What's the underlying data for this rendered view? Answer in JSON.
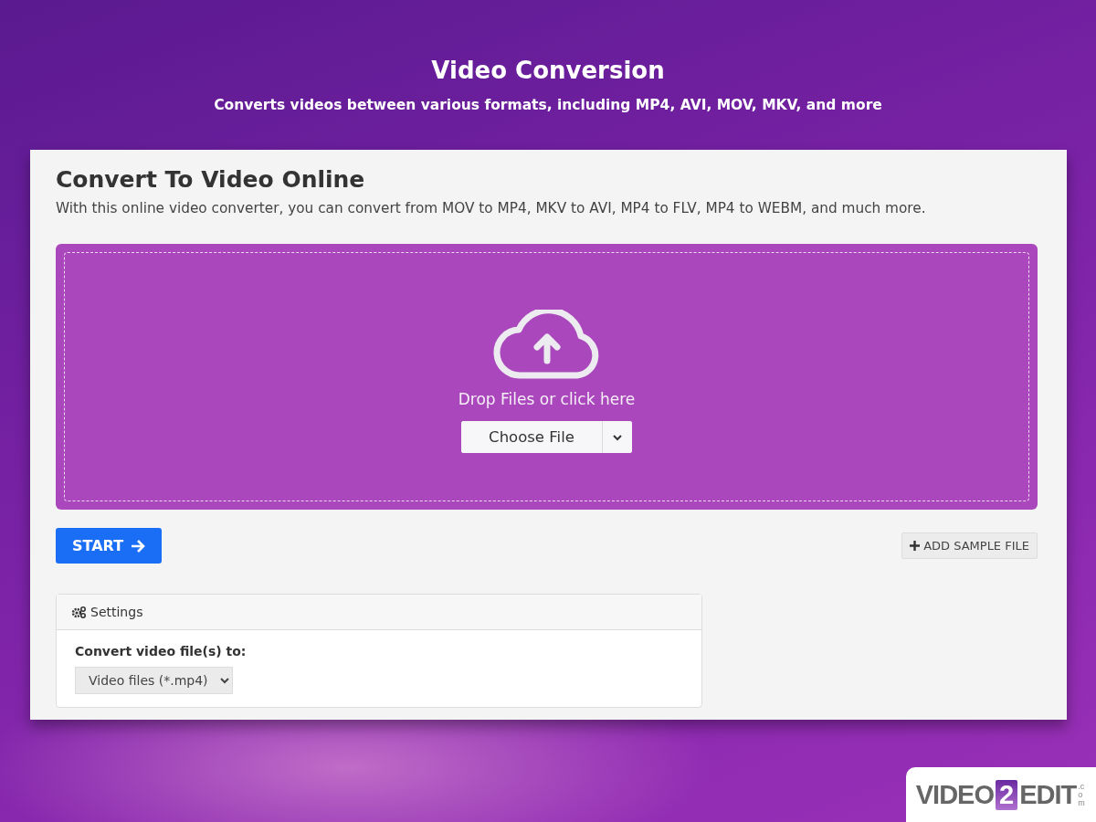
{
  "header": {
    "title": "Video Conversion",
    "subtitle": "Converts videos between various formats, including MP4, AVI, MOV, MKV, and more"
  },
  "card": {
    "title": "Convert To Video Online",
    "description": "With this online video converter, you can convert from MOV to MP4, MKV to AVI, MP4 to FLV, MP4 to WEBM, and much more."
  },
  "dropzone": {
    "prompt": "Drop Files or click here",
    "choose_button": "Choose File"
  },
  "start_button": "START",
  "sample_button": "ADD SAMPLE FILE",
  "settings": {
    "title": "Settings",
    "label": "Convert video file(s) to:",
    "value": "Video files (*.mp4)"
  },
  "logo": {
    "left": "VIDEO",
    "middle": "2",
    "right": "EDIT",
    "suffix": ".com"
  }
}
